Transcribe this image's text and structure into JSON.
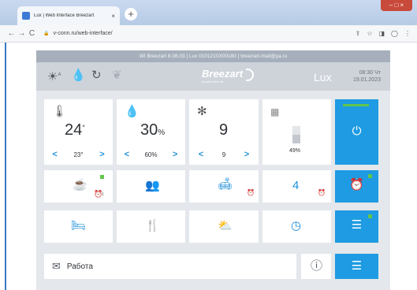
{
  "browser": {
    "tab_title": "Lux | Web Interface Breezart",
    "tab_close": "×",
    "new_tab": "+",
    "window_controls": "– □ ×",
    "back": "←",
    "forward": "→",
    "reload": "C",
    "lock": "🔒",
    "url": "v-conn.ru/web-interface/",
    "tools": [
      "⇪",
      "☆",
      "◨",
      "◯",
      "⋮"
    ]
  },
  "panel": {
    "info": "WI Breezart 8.06.03 | Lux 0101210X00180 | breezart-mail@ya.ru",
    "status_icons": [
      "sun-auto-icon",
      "drops-icon",
      "refresh-icon",
      "leaf-icon"
    ],
    "brand": "Breezart",
    "brand_sub": "the art of fresh air",
    "model": "Lux",
    "time": "08:30 Чт",
    "date": "19.01.2023"
  },
  "tiles": {
    "temperature": {
      "value": "24",
      "unit": "°",
      "setpoint": "23°",
      "left": "<",
      "right": ">"
    },
    "humidity": {
      "value": "30",
      "unit": "%",
      "setpoint": "60%",
      "left": "<",
      "right": ">"
    },
    "fan": {
      "value": "9",
      "setpoint": "9",
      "left": "<",
      "right": ">"
    },
    "filter": {
      "value": "49%",
      "level_fraction": 0.49
    },
    "scene_4": {
      "value": "4"
    },
    "timer_label": "1"
  },
  "footer": {
    "mode": "Работа"
  },
  "colors": {
    "accent_blue": "#1e9be2",
    "status_green": "#63c54a",
    "panel_bg": "#e4e7eb"
  }
}
